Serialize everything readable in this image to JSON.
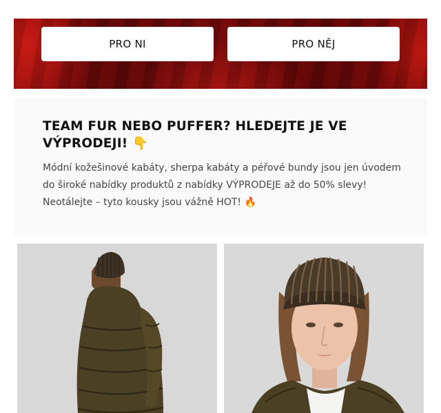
{
  "hero": {
    "buttons": [
      {
        "label": "PRO NI"
      },
      {
        "label": "PRO NĚJ"
      }
    ]
  },
  "promo": {
    "headline": "TEAM FUR NEBO PUFFER? HLEDEJTE JE VE VÝPRODEJI! 👇",
    "body": "Módní kožešinové kabáty, sherpa kabáty a péřové bundy jsou jen úvodem do široké nabídky produktů z nabídky VÝPRODEJE až do 50% slevy! Neotálejte – tyto kousky jsou vážně HOT! 🔥"
  },
  "colors": {
    "hero_red": "#7a0a0a",
    "button_bg": "#ffffff",
    "text_dark": "#111111",
    "coat_olive": "#4a3f22"
  }
}
